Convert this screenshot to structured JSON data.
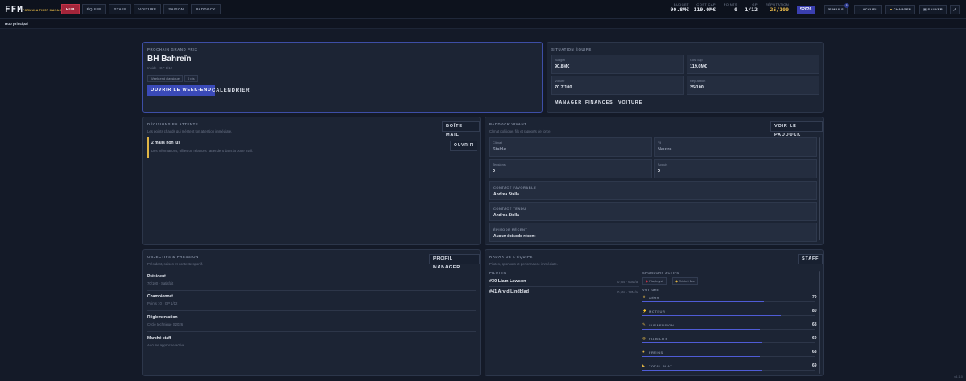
{
  "app": {
    "logo": "FFM",
    "subtitle": "FORMULA FIRST MANAGER"
  },
  "nav": [
    {
      "label": "HUB",
      "active": true
    },
    {
      "label": "ÉQUIPE"
    },
    {
      "label": "STAFF"
    },
    {
      "label": "VOITURE"
    },
    {
      "label": "SAISON"
    },
    {
      "label": "PADDOCK"
    }
  ],
  "stats": {
    "budget": {
      "label": "BUDGET",
      "value": "90.8M€"
    },
    "cost_cap": {
      "label": "COST CAP",
      "value": "119.0M€"
    },
    "points": {
      "label": "POINTS",
      "value": "0"
    },
    "gp": {
      "label": "GP",
      "value": "1/12"
    },
    "reputation": {
      "label": "RÉPUTATION",
      "value": "25/100"
    }
  },
  "season": "S2026",
  "topbuttons": {
    "mails": "MAILS",
    "mails_badge": "1",
    "accueil": "ACCUEIL",
    "charger": "CHARGER",
    "sauver": "SAUVER"
  },
  "breadcrumb": "Hub principal",
  "next_gp": {
    "title": "PROCHAIN GRAND PRIX",
    "name": "BH Bahreïn",
    "sub": "Inside · GP 1/12",
    "chips": [
      "Week-end classique",
      "0 pts"
    ],
    "open_btn": "OUVRIR LE WEEK-END",
    "calendar_btn": "CALENDRIER"
  },
  "situation": {
    "title": "SITUATION ÉQUIPE",
    "cells": [
      {
        "label": "Budget",
        "value": "90.8M€"
      },
      {
        "label": "Cost cap",
        "value": "119.0M€"
      },
      {
        "label": "Voiture",
        "value": "70.7/100"
      },
      {
        "label": "Réputation",
        "value": "25/100"
      }
    ],
    "links": [
      "MANAGER",
      "FINANCES",
      "VOITURE"
    ]
  },
  "decisions": {
    "title": "DÉCISIONS EN ATTENTE",
    "desc": "Les points chauds qui méritent ton attention immédiate.",
    "button": "BOÎTE MAIL",
    "item_title": "2 mails non lus",
    "item_sub": "Des informations, offres ou relances t'attendent dans la boîte mail.",
    "item_btn": "OUVRIR"
  },
  "paddock": {
    "title": "PADDOCK VIVANT",
    "desc": "Climat politique, fils et rapports de force.",
    "button": "VOIR LE PADDOCK",
    "cells": [
      {
        "label": "Climat",
        "value": "Stable"
      },
      {
        "label": "Fil",
        "value": "Neutre"
      },
      {
        "label": "Tensions",
        "value": "0"
      },
      {
        "label": "Appuis",
        "value": "0"
      }
    ],
    "rows": [
      {
        "label": "CONTACT FAVORABLE",
        "value": "Andrea Stella"
      },
      {
        "label": "CONTACT TENDU",
        "value": "Andrea Stella"
      },
      {
        "label": "ÉPISODE RÉCENT",
        "value": "Aucun épisode récent"
      }
    ]
  },
  "objectives": {
    "title": "OBJECTIFS & PRESSION",
    "desc": "Président, saison et contexte sportif.",
    "button": "PROFIL MANAGER",
    "items": [
      {
        "title": "Président",
        "sub": "70/100 · Satisfait"
      },
      {
        "title": "Championnat",
        "sub": "Points : 0 · GP 1/12"
      },
      {
        "title": "Réglementation",
        "sub": "Cycle technique S2026"
      },
      {
        "title": "Marché staff",
        "sub": "Aucune approche active"
      }
    ]
  },
  "radar": {
    "title": "RADAR DE L'ÉQUIPE",
    "desc": "Pilotes, sponsors et performance immédiate.",
    "button": "STAFF",
    "pilots_title": "PILOTES",
    "pilots": [
      {
        "name": "#30 Liam Lawson",
        "meta": "0 pts · 63M/a"
      },
      {
        "name": "#41 Arvid Lindblad",
        "meta": "0 pts · 18M/a"
      }
    ],
    "sponsors_title": "SPONSORS ACTIFS",
    "sponsors": [
      "Playboyst",
      "Cricket Bar"
    ],
    "car_title": "VOITURE",
    "car": [
      {
        "label": "AÉRO",
        "value": "70",
        "icon": "wind-icon",
        "glyph": "❖"
      },
      {
        "label": "MOTEUR",
        "value": "80",
        "icon": "bolt-icon",
        "glyph": "⚡"
      },
      {
        "label": "SUSPENSION",
        "value": "68",
        "icon": "wrench-icon",
        "glyph": "✎"
      },
      {
        "label": "FIABILITÉ",
        "value": "69",
        "icon": "shield-icon",
        "glyph": "◍"
      },
      {
        "label": "FREINS",
        "value": "68",
        "icon": "brake-icon",
        "glyph": "●"
      },
      {
        "label": "TOTAL PLAT",
        "value": "69",
        "icon": "gauge-icon",
        "glyph": "◣"
      }
    ]
  },
  "version": "v4.1.0"
}
